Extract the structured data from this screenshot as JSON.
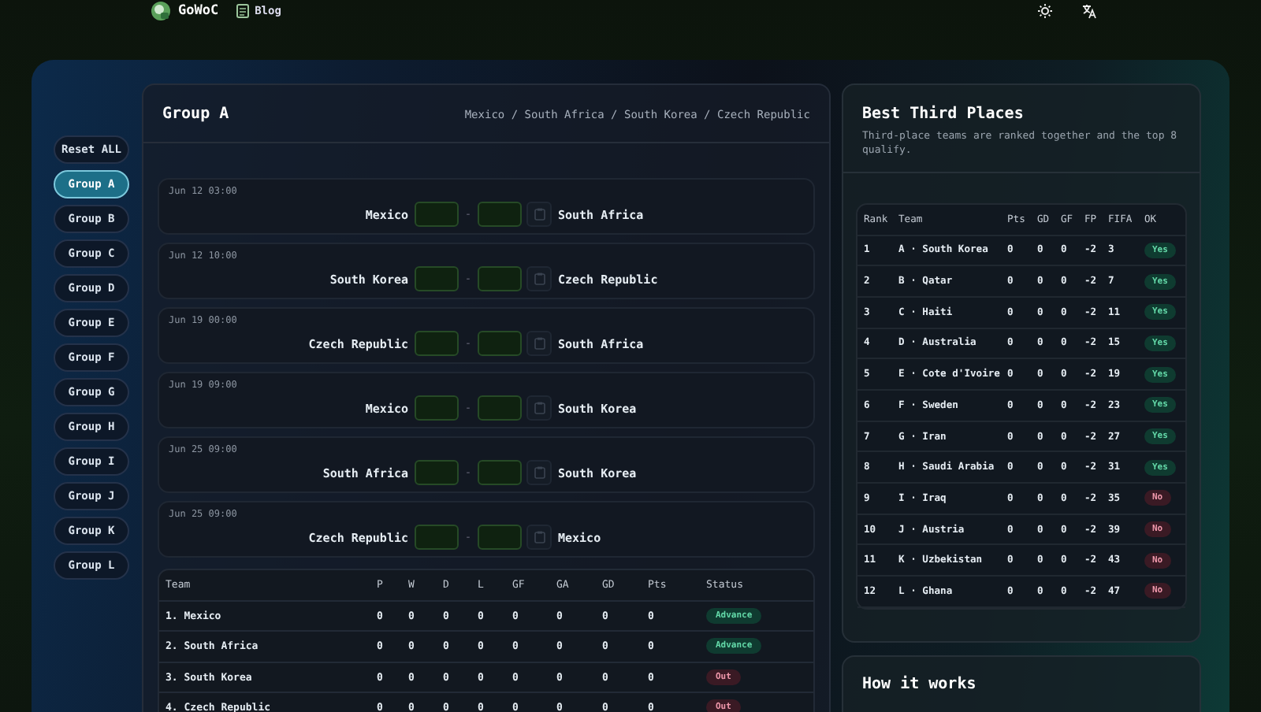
{
  "nav": {
    "brand": "GoWoC",
    "links": [
      {
        "label": "Blog"
      }
    ]
  },
  "sidebar": {
    "reset": "Reset ALL",
    "groups": [
      {
        "label": "Group A",
        "selected": true
      },
      {
        "label": "Group B",
        "selected": false
      },
      {
        "label": "Group C",
        "selected": false
      },
      {
        "label": "Group D",
        "selected": false
      },
      {
        "label": "Group E",
        "selected": false
      },
      {
        "label": "Group F",
        "selected": false
      },
      {
        "label": "Group G",
        "selected": false
      },
      {
        "label": "Group H",
        "selected": false
      },
      {
        "label": "Group I",
        "selected": false
      },
      {
        "label": "Group J",
        "selected": false
      },
      {
        "label": "Group K",
        "selected": false
      },
      {
        "label": "Group L",
        "selected": false
      }
    ]
  },
  "group": {
    "title": "Group A",
    "teams": "Mexico / South Africa / South Korea / Czech Republic",
    "matches": [
      {
        "time": "Jun 12 03:00",
        "home": "Mexico",
        "away": "South Africa",
        "separator": "-"
      },
      {
        "time": "Jun 12 10:00",
        "home": "South Korea",
        "away": "Czech Republic",
        "separator": "-"
      },
      {
        "time": "Jun 19 00:00",
        "home": "Czech Republic",
        "away": "South Africa",
        "separator": "-"
      },
      {
        "time": "Jun 19 09:00",
        "home": "Mexico",
        "away": "South Korea",
        "separator": "-"
      },
      {
        "time": "Jun 25 09:00",
        "home": "South Africa",
        "away": "South Korea",
        "separator": "-"
      },
      {
        "time": "Jun 25 09:00",
        "home": "Czech Republic",
        "away": "Mexico",
        "separator": "-"
      }
    ],
    "standings": {
      "columns": [
        "Team",
        "P",
        "W",
        "D",
        "L",
        "GF",
        "GA",
        "GD",
        "Pts",
        "Status"
      ],
      "rows": [
        {
          "cells": [
            "1. Mexico",
            "0",
            "0",
            "0",
            "0",
            "0",
            "0",
            "0",
            "0"
          ],
          "status": "Advance",
          "advance": true
        },
        {
          "cells": [
            "2. South Africa",
            "0",
            "0",
            "0",
            "0",
            "0",
            "0",
            "0",
            "0"
          ],
          "status": "Advance",
          "advance": true
        },
        {
          "cells": [
            "3. South Korea",
            "0",
            "0",
            "0",
            "0",
            "0",
            "0",
            "0",
            "0"
          ],
          "status": "Out",
          "advance": false
        },
        {
          "cells": [
            "4. Czech Republic",
            "0",
            "0",
            "0",
            "0",
            "0",
            "0",
            "0",
            "0"
          ],
          "status": "Out",
          "advance": false
        }
      ]
    }
  },
  "third_places": {
    "title": "Best Third Places",
    "description": "Third-place teams are ranked together and the top 8 qualify.",
    "columns": [
      "Rank",
      "Team",
      "Pts",
      "GD",
      "GF",
      "FP",
      "FIFA",
      "OK"
    ],
    "rows": [
      {
        "cells": [
          "1",
          "A · South Korea",
          "0",
          "0",
          "0",
          "-2",
          "3"
        ],
        "ok": "Yes",
        "qualified": true
      },
      {
        "cells": [
          "2",
          "B · Qatar",
          "0",
          "0",
          "0",
          "-2",
          "7"
        ],
        "ok": "Yes",
        "qualified": true
      },
      {
        "cells": [
          "3",
          "C · Haiti",
          "0",
          "0",
          "0",
          "-2",
          "11"
        ],
        "ok": "Yes",
        "qualified": true
      },
      {
        "cells": [
          "4",
          "D · Australia",
          "0",
          "0",
          "0",
          "-2",
          "15"
        ],
        "ok": "Yes",
        "qualified": true
      },
      {
        "cells": [
          "5",
          "E · Cote d'Ivoire",
          "0",
          "0",
          "0",
          "-2",
          "19"
        ],
        "ok": "Yes",
        "qualified": true
      },
      {
        "cells": [
          "6",
          "F · Sweden",
          "0",
          "0",
          "0",
          "-2",
          "23"
        ],
        "ok": "Yes",
        "qualified": true
      },
      {
        "cells": [
          "7",
          "G · Iran",
          "0",
          "0",
          "0",
          "-2",
          "27"
        ],
        "ok": "Yes",
        "qualified": true
      },
      {
        "cells": [
          "8",
          "H · Saudi Arabia",
          "0",
          "0",
          "0",
          "-2",
          "31"
        ],
        "ok": "Yes",
        "qualified": true
      },
      {
        "cells": [
          "9",
          "I · Iraq",
          "0",
          "0",
          "0",
          "-2",
          "35"
        ],
        "ok": "No",
        "qualified": false
      },
      {
        "cells": [
          "10",
          "J · Austria",
          "0",
          "0",
          "0",
          "-2",
          "39"
        ],
        "ok": "No",
        "qualified": false
      },
      {
        "cells": [
          "11",
          "K · Uzbekistan",
          "0",
          "0",
          "0",
          "-2",
          "43"
        ],
        "ok": "No",
        "qualified": false
      },
      {
        "cells": [
          "12",
          "L · Ghana",
          "0",
          "0",
          "0",
          "-2",
          "47"
        ],
        "ok": "No",
        "qualified": false
      }
    ]
  },
  "how_it_works": {
    "title": "How it works"
  }
}
